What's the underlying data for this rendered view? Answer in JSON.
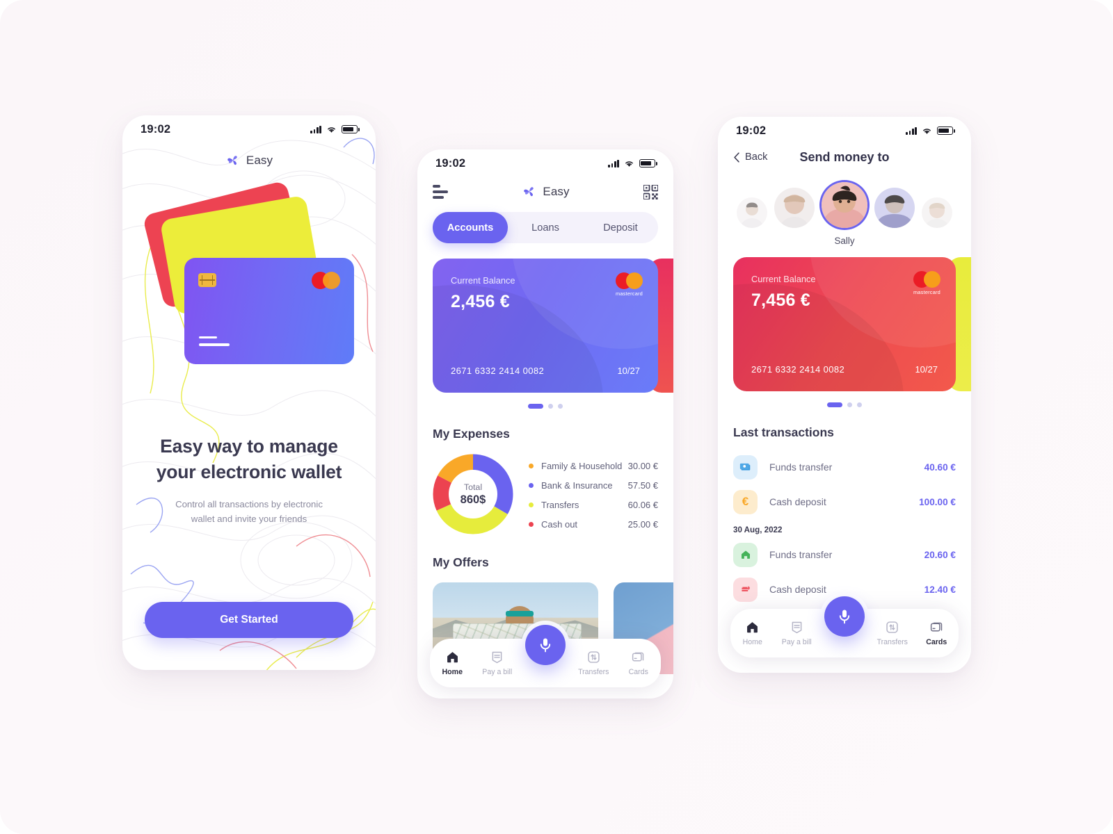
{
  "theme": {
    "accent": "#6a63ef",
    "page_bg": "#fbf6f9",
    "red": "#ed4352",
    "yellow": "#eced3a",
    "orange": "#f9a828",
    "green": "#45b35a"
  },
  "onboarding": {
    "status": {
      "time": "19:02"
    },
    "brand": {
      "name": "Easy",
      "logo_icon": "pinwheel-icon"
    },
    "headline": "Easy way to manage your  electronic wallet",
    "headline_line1": "Easy way to manage",
    "headline_line2": "your  electronic wallet",
    "subtext_line1": "Control all transactions by electronic",
    "subtext_line2": "wallet and invite your friends",
    "cta_label": "Get Started",
    "card_brand": "mastercard"
  },
  "home": {
    "status": {
      "time": "19:02"
    },
    "brand": {
      "name": "Easy",
      "logo_icon": "pinwheel-icon"
    },
    "menu_icon": "hamburger-icon",
    "qr_icon": "qr-code-icon",
    "tabs": [
      {
        "label": "Accounts",
        "active": true
      },
      {
        "label": "Loans",
        "active": false
      },
      {
        "label": "Deposit",
        "active": false
      }
    ],
    "card": {
      "label": "Current Balance",
      "amount": "2,456 €",
      "number": "2671 6332 2414 0082",
      "expiry": "10/27",
      "brand": "mastercard"
    },
    "carousel": {
      "total": 3,
      "active_index": 0
    },
    "expenses_title": "My Expenses",
    "offers_title": "My Offers",
    "bottom_nav": [
      {
        "label": "Home",
        "icon": "home-icon",
        "active": true
      },
      {
        "label": "Pay a bill",
        "icon": "bill-icon",
        "active": false
      },
      {
        "label": "Transfers",
        "icon": "transfers-icon",
        "active": false
      },
      {
        "label": "Cards",
        "icon": "cards-icon",
        "active": false
      }
    ],
    "mic_icon": "microphone-icon"
  },
  "chart_data": {
    "type": "pie",
    "title": "My Expenses",
    "center_label": "Total",
    "center_value": "860$",
    "categories": [
      "Family & Household",
      "Bank & Insurance",
      "Transfers",
      "Cash out"
    ],
    "values": [
      30.0,
      57.5,
      60.06,
      25.0
    ],
    "value_labels": [
      "30.00 €",
      "57.50 €",
      "60.06 €",
      "25.00 €"
    ],
    "colors": [
      "#f9a828",
      "#6a63ef",
      "#e6ec3c",
      "#ec4350"
    ],
    "legend_position": "right",
    "donut": true
  },
  "send": {
    "status": {
      "time": "19:02"
    },
    "back_label": "Back",
    "back_icon": "chevron-left-icon",
    "title": "Send money to",
    "selected_contact": "Sally",
    "card": {
      "label": "Current Balance",
      "amount": "7,456 €",
      "number": "2671 6332 2414 0082",
      "expiry": "10/27",
      "brand": "mastercard"
    },
    "carousel": {
      "total": 3,
      "active_index": 0
    },
    "transactions_title": "Last transactions",
    "transactions": [
      {
        "name": "Funds transfer",
        "amount": "40.60 €",
        "icon": "banknote-icon",
        "icon_bg": "#ddeefb",
        "icon_color": "#3b9bdf"
      },
      {
        "name": "Cash deposit",
        "amount": "100.00 €",
        "icon": "euro-icon",
        "icon_bg": "#fdeccd",
        "icon_color": "#f9a828"
      }
    ],
    "date_divider": "30 Aug, 2022",
    "transactions2": [
      {
        "name": "Funds transfer",
        "amount": "20.60 €",
        "icon": "home-icon",
        "icon_bg": "#d9f2de",
        "icon_color": "#45b35a"
      },
      {
        "name": "Cash deposit",
        "amount": "12.40 €",
        "icon": "food-icon",
        "icon_bg": "#fcdde0",
        "icon_color": "#ec4350"
      }
    ],
    "bottom_nav": [
      {
        "label": "Home",
        "icon": "home-icon",
        "active": false
      },
      {
        "label": "Pay a bill",
        "icon": "bill-icon",
        "active": false
      },
      {
        "label": "Transfers",
        "icon": "transfers-icon",
        "active": false
      },
      {
        "label": "Cards",
        "icon": "cards-icon",
        "active": true
      }
    ],
    "mic_icon": "microphone-icon"
  }
}
